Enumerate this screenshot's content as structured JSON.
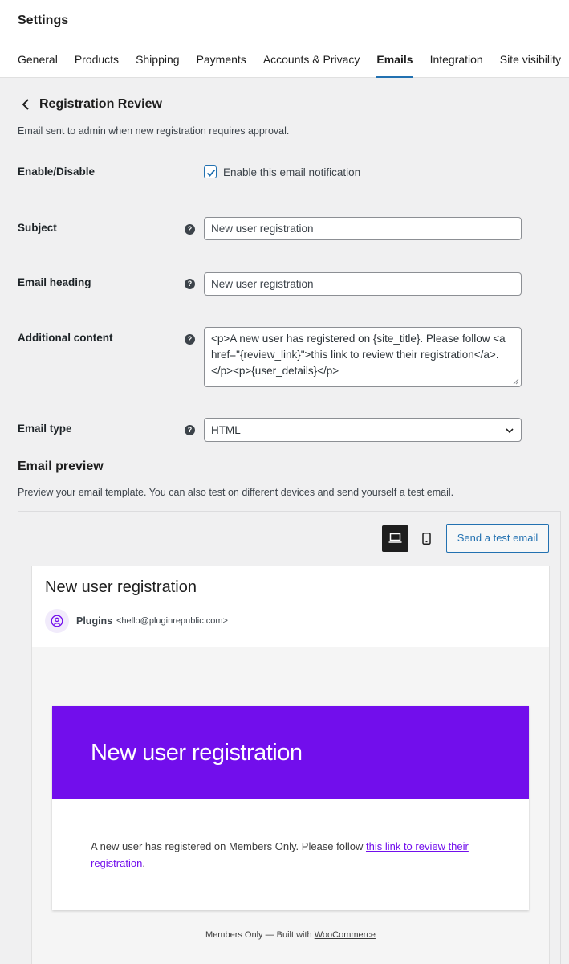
{
  "header": {
    "title": "Settings",
    "tabs": [
      {
        "label": "General"
      },
      {
        "label": "Products"
      },
      {
        "label": "Shipping"
      },
      {
        "label": "Payments"
      },
      {
        "label": "Accounts & Privacy"
      },
      {
        "label": "Emails",
        "active": true
      },
      {
        "label": "Integration"
      },
      {
        "label": "Site visibility"
      }
    ]
  },
  "page": {
    "title": "Registration Review",
    "description": "Email sent to admin when new registration requires approval."
  },
  "form": {
    "enable": {
      "label": "Enable/Disable",
      "checkbox_label": "Enable this email notification",
      "checked": true
    },
    "subject": {
      "label": "Subject",
      "value": "New user registration"
    },
    "heading": {
      "label": "Email heading",
      "value": "New user registration"
    },
    "additional": {
      "label": "Additional content",
      "value": "<p>A new user has registered on {site_title}. Please follow <a href=\"{review_link}\">this link to review their registration</a>.</p><p>{user_details}</p>"
    },
    "type": {
      "label": "Email type",
      "value": "HTML"
    }
  },
  "preview": {
    "title": "Email preview",
    "description": "Preview your email template. You can also test on different devices and send yourself a test email.",
    "send_test_label": "Send a test email",
    "email": {
      "subject": "New user registration",
      "sender_name": "Plugins",
      "sender_email": "<hello@pluginrepublic.com>",
      "header_text": "New user registration",
      "body_prefix": "A new user has registered on Members Only. Please follow ",
      "body_link": "this link to review their registration",
      "body_suffix": ".",
      "footer_prefix": "Members Only — Built with ",
      "footer_link": "WooCommerce"
    }
  },
  "colors": {
    "accent": "#2271b1",
    "brand_purple": "#720eec"
  }
}
